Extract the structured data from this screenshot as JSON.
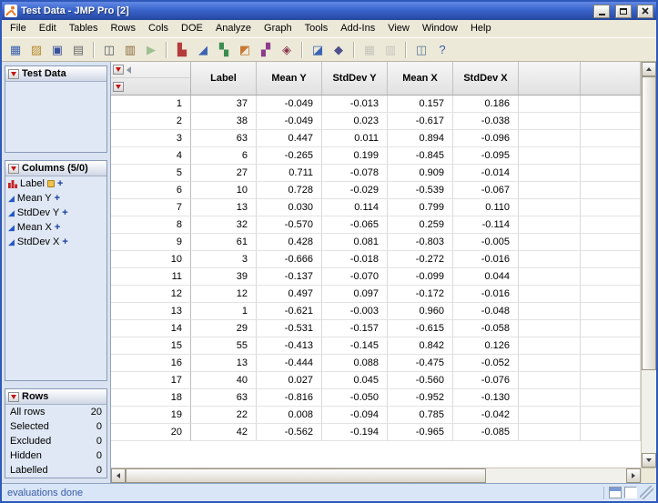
{
  "window": {
    "title": "Test Data - JMP Pro [2]"
  },
  "menu": {
    "items": [
      "File",
      "Edit",
      "Tables",
      "Rows",
      "Cols",
      "DOE",
      "Analyze",
      "Graph",
      "Tools",
      "Add-Ins",
      "View",
      "Window",
      "Help"
    ]
  },
  "toolbar": {
    "groups": [
      [
        {
          "name": "new-data-table",
          "glyph": "▦",
          "color": "#3a62b0"
        },
        {
          "name": "open",
          "glyph": "▨",
          "color": "#b8892e"
        },
        {
          "name": "save",
          "glyph": "▣",
          "color": "#39519b"
        },
        {
          "name": "print",
          "glyph": "▤",
          "color": "#6a6a6a"
        }
      ],
      [
        {
          "name": "copy",
          "glyph": "◫",
          "color": "#55585e"
        },
        {
          "name": "paste",
          "glyph": "▥",
          "color": "#8a6a3a"
        },
        {
          "name": "run-script",
          "glyph": "▶",
          "color": "#3f8f3f",
          "disabled": true
        }
      ],
      [
        {
          "name": "distribution",
          "glyph": "▙",
          "color": "#b43c3c"
        },
        {
          "name": "fit-y-by-x",
          "glyph": "◢",
          "color": "#3c64b4"
        },
        {
          "name": "fit-model",
          "glyph": "▚",
          "color": "#3c8c50"
        },
        {
          "name": "graph-builder",
          "glyph": "◩",
          "color": "#c87832"
        },
        {
          "name": "multivariate",
          "glyph": "▞",
          "color": "#8c3c8c"
        },
        {
          "name": "control-chart",
          "glyph": "◈",
          "color": "#8c3c50"
        }
      ],
      [
        {
          "name": "data-filter",
          "glyph": "◪",
          "color": "#3c64b4"
        },
        {
          "name": "scatterplot-3d",
          "glyph": "◆",
          "color": "#50508c"
        }
      ],
      [
        {
          "name": "summary",
          "glyph": "▦",
          "color": "#9a9a9a",
          "disabled": true
        },
        {
          "name": "join",
          "glyph": "▥",
          "color": "#9a9a9a",
          "disabled": true
        }
      ],
      [
        {
          "name": "window-layout",
          "glyph": "◫",
          "color": "#5a7a9a"
        },
        {
          "name": "help",
          "glyph": "?",
          "color": "#3a5ab0"
        }
      ]
    ]
  },
  "sidebar": {
    "table_panel": {
      "title": "Test Data"
    },
    "columns_panel": {
      "title": "Columns (5/0)",
      "items": [
        {
          "label": "Label",
          "type_icon": "histogram",
          "extras": [
            "label-tag",
            "formula-plus"
          ]
        },
        {
          "label": "Mean Y",
          "type_icon": "continuous",
          "extras": [
            "formula-plus"
          ]
        },
        {
          "label": "StdDev Y",
          "type_icon": "continuous",
          "extras": [
            "formula-plus"
          ]
        },
        {
          "label": "Mean X",
          "type_icon": "continuous",
          "extras": [
            "formula-plus"
          ]
        },
        {
          "label": "StdDev X",
          "type_icon": "continuous",
          "extras": [
            "formula-plus"
          ]
        }
      ]
    },
    "rows_panel": {
      "title": "Rows",
      "stats": [
        {
          "label": "All rows",
          "value": "20"
        },
        {
          "label": "Selected",
          "value": "0"
        },
        {
          "label": "Excluded",
          "value": "0"
        },
        {
          "label": "Hidden",
          "value": "0"
        },
        {
          "label": "Labelled",
          "value": "0"
        }
      ]
    }
  },
  "table": {
    "columns": [
      "Label",
      "Mean Y",
      "StdDev Y",
      "Mean X",
      "StdDev X"
    ],
    "rows": [
      {
        "n": "1",
        "values": [
          "37",
          "-0.049",
          "-0.013",
          "0.157",
          "0.186"
        ]
      },
      {
        "n": "2",
        "values": [
          "38",
          "-0.049",
          "0.023",
          "-0.617",
          "-0.038"
        ]
      },
      {
        "n": "3",
        "values": [
          "63",
          "0.447",
          "0.011",
          "0.894",
          "-0.096"
        ]
      },
      {
        "n": "4",
        "values": [
          "6",
          "-0.265",
          "0.199",
          "-0.845",
          "-0.095"
        ]
      },
      {
        "n": "5",
        "values": [
          "27",
          "0.711",
          "-0.078",
          "0.909",
          "-0.014"
        ]
      },
      {
        "n": "6",
        "values": [
          "10",
          "0.728",
          "-0.029",
          "-0.539",
          "-0.067"
        ]
      },
      {
        "n": "7",
        "values": [
          "13",
          "0.030",
          "0.114",
          "0.799",
          "0.110"
        ]
      },
      {
        "n": "8",
        "values": [
          "32",
          "-0.570",
          "-0.065",
          "0.259",
          "-0.114"
        ]
      },
      {
        "n": "9",
        "values": [
          "61",
          "0.428",
          "0.081",
          "-0.803",
          "-0.005"
        ]
      },
      {
        "n": "10",
        "values": [
          "3",
          "-0.666",
          "-0.018",
          "-0.272",
          "-0.016"
        ]
      },
      {
        "n": "11",
        "values": [
          "39",
          "-0.137",
          "-0.070",
          "-0.099",
          "0.044"
        ]
      },
      {
        "n": "12",
        "values": [
          "12",
          "0.497",
          "0.097",
          "-0.172",
          "-0.016"
        ]
      },
      {
        "n": "13",
        "values": [
          "1",
          "-0.621",
          "-0.003",
          "0.960",
          "-0.048"
        ]
      },
      {
        "n": "14",
        "values": [
          "29",
          "-0.531",
          "-0.157",
          "-0.615",
          "-0.058"
        ]
      },
      {
        "n": "15",
        "values": [
          "55",
          "-0.413",
          "-0.145",
          "0.842",
          "0.126"
        ]
      },
      {
        "n": "16",
        "values": [
          "13",
          "-0.444",
          "0.088",
          "-0.475",
          "-0.052"
        ]
      },
      {
        "n": "17",
        "values": [
          "40",
          "0.027",
          "0.045",
          "-0.560",
          "-0.076"
        ]
      },
      {
        "n": "18",
        "values": [
          "63",
          "-0.816",
          "-0.050",
          "-0.952",
          "-0.130"
        ]
      },
      {
        "n": "19",
        "values": [
          "22",
          "0.008",
          "-0.094",
          "0.785",
          "-0.042"
        ]
      },
      {
        "n": "20",
        "values": [
          "42",
          "-0.562",
          "-0.194",
          "-0.965",
          "-0.085"
        ]
      }
    ]
  },
  "status": {
    "text": "evaluations done"
  }
}
